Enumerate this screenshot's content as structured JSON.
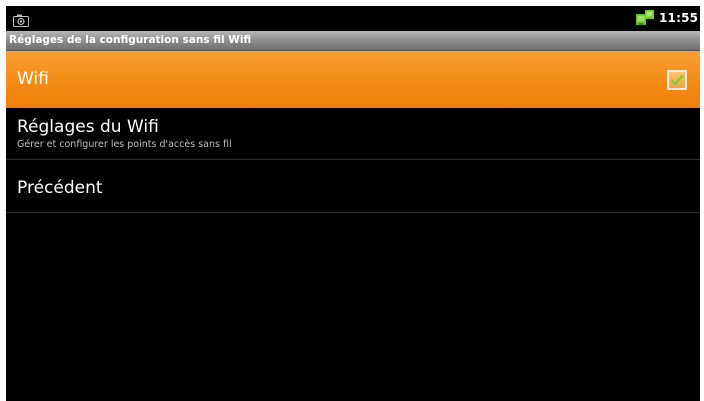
{
  "status_bar": {
    "time": "11:55",
    "left_icon": "camera-icon",
    "right_icon": "network-data-icon"
  },
  "title_bar": {
    "title": "Réglages de la configuration sans fil Wifi"
  },
  "list": {
    "items": [
      {
        "label": "Wifi",
        "checked": true,
        "highlighted": true
      },
      {
        "label": "Réglages du Wifi",
        "summary": "Gérer et configurer les points d'accès sans fil"
      },
      {
        "label": "Précédent"
      }
    ]
  },
  "colors": {
    "highlight": "#f38a13",
    "background": "#000000",
    "title_bar": "#8a8a8a",
    "network_icon": "#6ccc28"
  }
}
